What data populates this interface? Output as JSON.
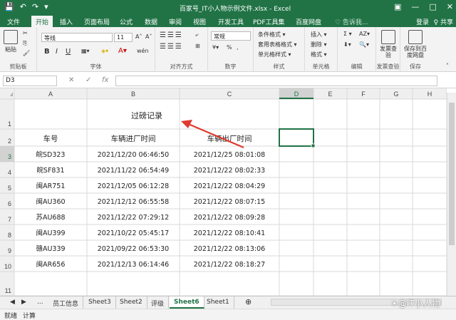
{
  "titlebar": {
    "title": "百家号_IT小人物示例文件.xlsx - Excel",
    "qat": [
      "💾",
      "↶",
      "↷",
      "▾"
    ],
    "win": [
      "▣",
      "—",
      "□",
      "✕"
    ]
  },
  "tabs": {
    "items": [
      "文件",
      "开始",
      "插入",
      "页面布局",
      "公式",
      "数据",
      "审阅",
      "视图",
      "开发工具",
      "PDF工具集",
      "百度网盘",
      "♡ 告诉我..."
    ],
    "active": "开始",
    "login": "登录",
    "share": "♀ 共享"
  },
  "ribbon": {
    "clipboard": {
      "paste": "粘贴",
      "label": "剪贴板"
    },
    "font": {
      "name": "等线",
      "size": "11",
      "inc": "A˄",
      "dec": "A˅",
      "bold": "B",
      "italic": "I",
      "underline": "U",
      "wen": "wén",
      "label": "字体"
    },
    "align": {
      "label": "对齐方式"
    },
    "number": {
      "format": "常规",
      "percent": "%",
      "comma": ",",
      "label": "数字"
    },
    "styles": {
      "cond": "条件格式 ▾",
      "table": "套用表格格式 ▾",
      "cell": "单元格样式 ▾",
      "label": "样式"
    },
    "cells": {
      "insert": "插入 ▾",
      "delete": "删除 ▾",
      "format": "格式 ▾",
      "label": "单元格"
    },
    "edit": {
      "sum": "Σ ▾",
      "sort": "AZ▾",
      "find": "🔍▾",
      "label": "编辑"
    },
    "invoice": {
      "btn": "发票查验",
      "label": "发票查验"
    },
    "baidu": {
      "btn": "保存到百度网盘",
      "label": "保存"
    }
  },
  "formula_bar": {
    "cell": "D3",
    "cancel": "✕",
    "enter": "✓",
    "fx": "fx",
    "value": ""
  },
  "sheet": {
    "col_headers": [
      "A",
      "B",
      "C",
      "D",
      "E",
      "F",
      "G",
      "H"
    ],
    "row_headers": [
      "1",
      "2",
      "3",
      "4",
      "5",
      "6",
      "7",
      "8",
      "9",
      "10",
      "11"
    ],
    "title": "过磅记录",
    "headers": [
      "车号",
      "车辆进厂时间",
      "车辆出厂时间"
    ],
    "rows": [
      [
        "皖SD323",
        "2021/12/20 06:46:50",
        "2021/12/25 08:01:08"
      ],
      [
        "皖SF831",
        "2021/11/22 06:54:49",
        "2021/12/22 08:02:33"
      ],
      [
        "闽AR751",
        "2021/12/05 06:12:28",
        "2021/12/22 08:04:29"
      ],
      [
        "闽AU360",
        "2021/12/12 06:55:58",
        "2021/12/22 08:07:15"
      ],
      [
        "苏AU688",
        "2021/12/22 07:29:12",
        "2021/12/22 08:09:28"
      ],
      [
        "闽AU399",
        "2021/10/22 05:45:17",
        "2021/12/22 08:10:41"
      ],
      [
        "赣AU339",
        "2021/09/22 06:53:30",
        "2021/12/22 08:13:06"
      ],
      [
        "闽AR656",
        "2021/12/13 06:14:46",
        "2021/12/22 08:18:27"
      ]
    ],
    "selected": "D3",
    "accent": "#217346",
    "arrow_color": "#e03a2e"
  },
  "sheets": {
    "nav": [
      "◀",
      "▶"
    ],
    "dots": "...",
    "tabs": [
      "员工信息",
      "Sheet3",
      "Sheet2",
      "评级",
      "Sheet6",
      "Sheet1"
    ],
    "active": "Sheet6",
    "add": "⊕"
  },
  "status": {
    "ready": "就绪",
    "calc": "计算"
  },
  "watermark": "☀@IT小人物"
}
